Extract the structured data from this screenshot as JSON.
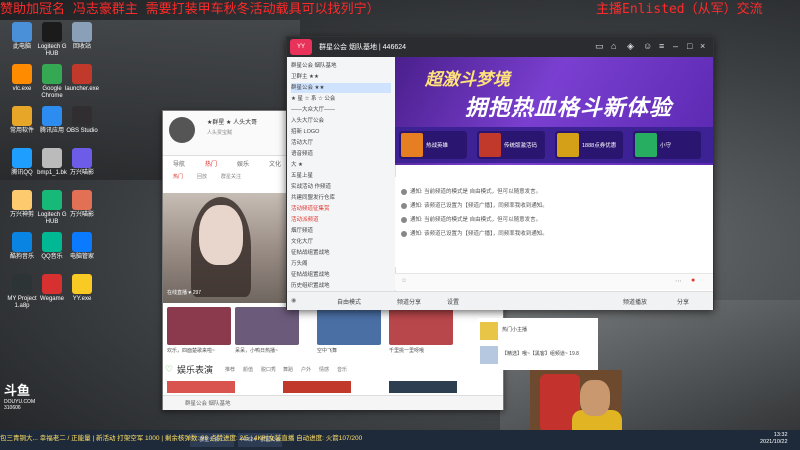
{
  "banner": {
    "left_text": "赞助加冠名 冯志豪群主 需要打装甲车秋冬活动载具可以找列宁）",
    "right_text": "主播Enlisted（从军）交流"
  },
  "desktop_icons": [
    {
      "label": "此电脑",
      "color": "#4a90d9"
    },
    {
      "label": "Logitech G HUB",
      "color": "#1b1b1b"
    },
    {
      "label": "回收站",
      "color": "#8aa0b8"
    },
    {
      "label": "vlc.exe",
      "color": "#ff8c00"
    },
    {
      "label": "Google Chrome",
      "color": "#34a853"
    },
    {
      "label": "launcher.exe",
      "color": "#c0392b"
    },
    {
      "label": "常用软件",
      "color": "#e7a627"
    },
    {
      "label": "腾讯应用",
      "color": "#2d8cf0"
    },
    {
      "label": "OBS Studio",
      "color": "#302e31"
    },
    {
      "label": "腾讯QQ",
      "color": "#1e9fff"
    },
    {
      "label": "bmp1_1.bk",
      "color": "#bbbbbb"
    },
    {
      "label": "万兴喵影",
      "color": "#6c5ce7"
    },
    {
      "label": "万兴神剪",
      "color": "#fdcb6e"
    },
    {
      "label": "Logitech G HUB",
      "color": "#17b978"
    },
    {
      "label": "万兴喵影",
      "color": "#e17055"
    },
    {
      "label": "酷狗音乐",
      "color": "#0984e3"
    },
    {
      "label": "QQ音乐",
      "color": "#00b894"
    },
    {
      "label": "电脑管家",
      "color": "#0a7bff"
    },
    {
      "label": "MY Project 1.a8p",
      "color": "#2d3436"
    },
    {
      "label": "Wegame",
      "color": "#d63031"
    },
    {
      "label": "YY.exe",
      "color": "#f9ca24"
    }
  ],
  "chat_window": {
    "title": "群星公会 烟队基地 | 446624",
    "group_id": "446624",
    "left_items": [
      "群星公会  烟队基地",
      "卫群主 ★★",
      "群星公会  ★★",
      "★ 星 ☆ 系 ☆ 公会",
      "——大众大厅——",
      "入头大厅公会",
      "招新  LOGO",
      "活动大厅",
      "语音频道",
      "大 ★",
      "五星上星",
      "实战活动  作频道",
      "共建同盟发行仓库",
      "活动频道征集赏",
      "活动派频道",
      "烟厅频道",
      "文化大厅",
      "征帖战组置战地",
      "万头阁",
      "征帖战组置战地",
      "历史组织置战地",
      "空军组织置战地"
    ],
    "promo_title_1": "超激斗梦境",
    "promo_title_2": "拥抱热血格斗新体验",
    "cards": [
      "热战英雄",
      "传统版激活码",
      "1888点券优惠",
      "小守"
    ],
    "messages": [
      "通知: 当前频道的模式是 自由模式，但可以随意发言。",
      "通知: 该频道已设置为【频道广播】，同频率我收到通知。",
      "通知: 当前频道的模式是 自由模式，但可以随意发言。",
      "通知: 该频道已设置为【频道广播】，同频率我收到通知。"
    ],
    "input_placeholder": "",
    "status_items": [
      "自由模式",
      "频道分享",
      "设置",
      "频道播放",
      "分享"
    ]
  },
  "game_window": {
    "name": "★群星 ★  人头大哥",
    "sub": "人头贾宝贼",
    "tabs": [
      "导航",
      "热门",
      "娱乐",
      "文化"
    ],
    "sub_tabs": [
      "热门",
      "回放",
      "群星关注"
    ],
    "photo_caption": "在线直播 ♥ 297",
    "section_title": "娱乐表演",
    "section_items": [
      "推荐",
      "颜值",
      "脱口秀",
      "舞蹈",
      "户外",
      "情感",
      "音乐"
    ],
    "grid_captions": [
      "欢乐，四面楚歌来啦~",
      "呆呆，小鸭日热播~",
      "空中飞舞",
      "千里挑一里呀哦"
    ],
    "footer": "群星公会  烟队基地"
  },
  "side_panel": {
    "items": [
      "热门小主播",
      "【精选】哦~【黑客】组频道~ 19.8"
    ]
  },
  "ticker": "包三青铜大... 幸福老二 / 正能量 | 新活动 打架空军 1000 | 剩余核弹数: 96 点赞进度: 2/5 | 4K时女装直播 自动进度: 火箭107/200",
  "clock": {
    "time": "13:32",
    "date": "2021/10/22"
  },
  "watermark": {
    "logo": "斗鱼",
    "site": "DOUYU.COM",
    "room": "310606"
  },
  "taskbar": [
    "群星公会 ...",
    "446624 - 群星公会"
  ]
}
